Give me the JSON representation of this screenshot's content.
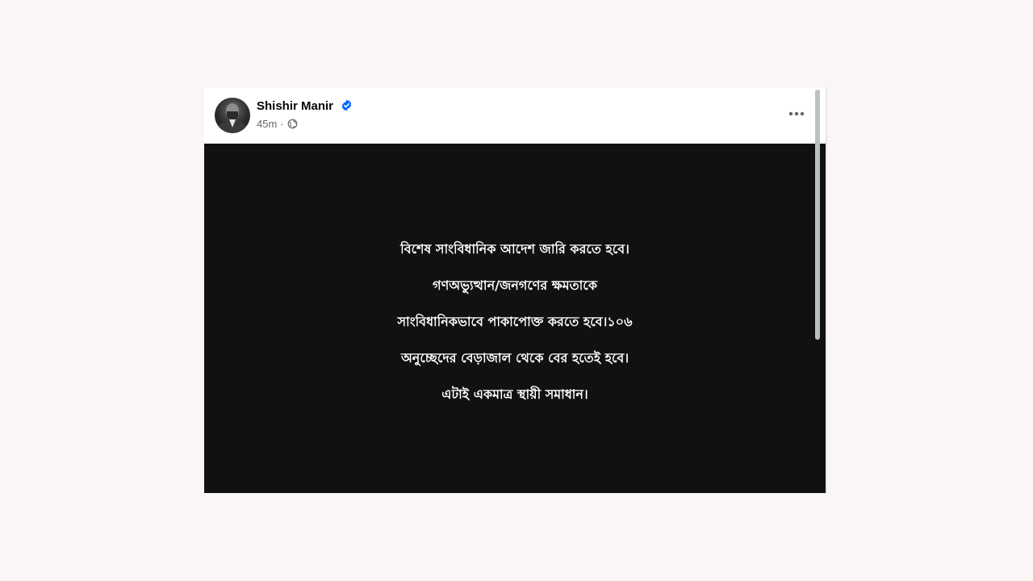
{
  "post": {
    "author": {
      "name": "Shishir Manir",
      "verified": true,
      "avatar": "profile-photo"
    },
    "timestamp": "45m",
    "separator": "·",
    "audience_icon": "globe-icon",
    "more_icon": "more-horizontal-icon",
    "image_text_lines": [
      "বিশেষ সাংবিধানিক আদেশ জারি করতে হবে।",
      "গণঅভ্যুত্থান/জনগণের ক্ষমতাকে",
      "সাংবিধানিকভাবে পাকাপোক্ত করতে হবে।১০৬",
      "অনুচ্ছেদের বেড়াজাল থেকে বের হতেই হবে।",
      "এটাই একমাত্র স্থায়ী সমাধান।"
    ]
  },
  "colors": {
    "page_background": "#f9f6f5",
    "card_background": "#ffffff",
    "image_background": "#111111",
    "image_text": "#ffffff",
    "verified_badge": "#0866ff",
    "meta_text": "#65676b"
  }
}
